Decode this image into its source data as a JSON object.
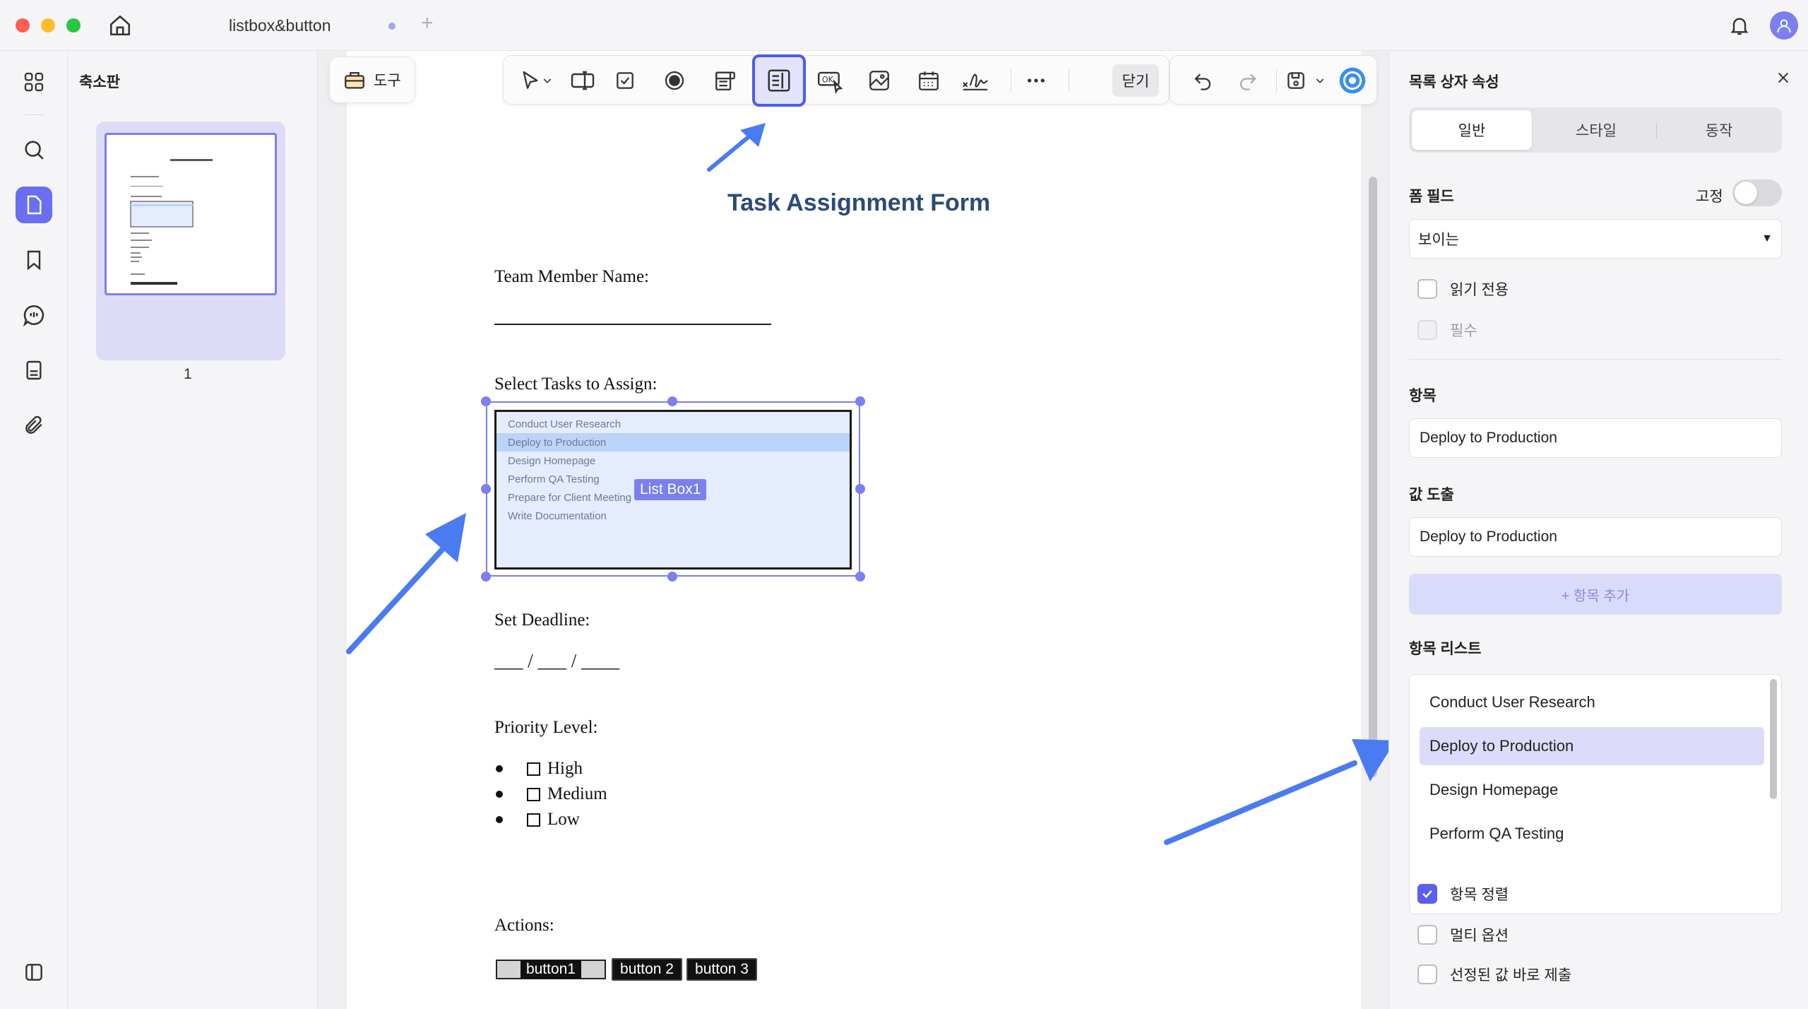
{
  "window": {
    "tab_title": "listbox&button"
  },
  "thumbnails": {
    "title": "축소판",
    "page_number": "1"
  },
  "toolbar": {
    "tools_label": "도구",
    "close_label": "닫기"
  },
  "document": {
    "title": "Task Assignment Form",
    "name_label": "Team Member Name:",
    "tasks_label": "Select Tasks to Assign:",
    "listbox_items": [
      "Conduct User Research",
      "Deploy to Production",
      "Design Homepage",
      "Perform QA Testing",
      "Prepare for Client Meeting",
      "Write Documentation"
    ],
    "listbox_selected": "Deploy to Production",
    "listbox_label": "List Box1",
    "deadline_label": "Set Deadline:",
    "deadline_blank": "___ / ___ / ____",
    "priority_label": "Priority Level:",
    "priority_options": [
      "High",
      "Medium",
      "Low"
    ],
    "actions_label": "Actions:",
    "buttons": [
      "button1",
      "button 2",
      "button 3"
    ]
  },
  "properties": {
    "title": "목록 상자 속성",
    "tabs": [
      "일반",
      "스타일",
      "동작"
    ],
    "form_field_label": "폼 필드",
    "lock_label": "고정",
    "visibility_value": "보이는",
    "readonly_label": "읽기 전용",
    "required_label": "필수",
    "item_label": "항목",
    "item_value": "Deploy to Production",
    "export_label": "값 도출",
    "export_value": "Deploy to Production",
    "add_item_label": "+ 항목 추가",
    "item_list_label": "항목 리스트",
    "item_list": [
      "Conduct User Research",
      "Deploy to Production",
      "Design Homepage",
      "Perform QA Testing"
    ],
    "sort_label": "항목 정렬",
    "multi_label": "멀티 옵션",
    "commit_label": "선정된 값 바로 제출"
  },
  "colors": {
    "accent": "#6a6ef0",
    "doc_title": "#2c4a78",
    "listbox_bg": "#e4ecfd",
    "arrow": "#4a7bf0"
  }
}
